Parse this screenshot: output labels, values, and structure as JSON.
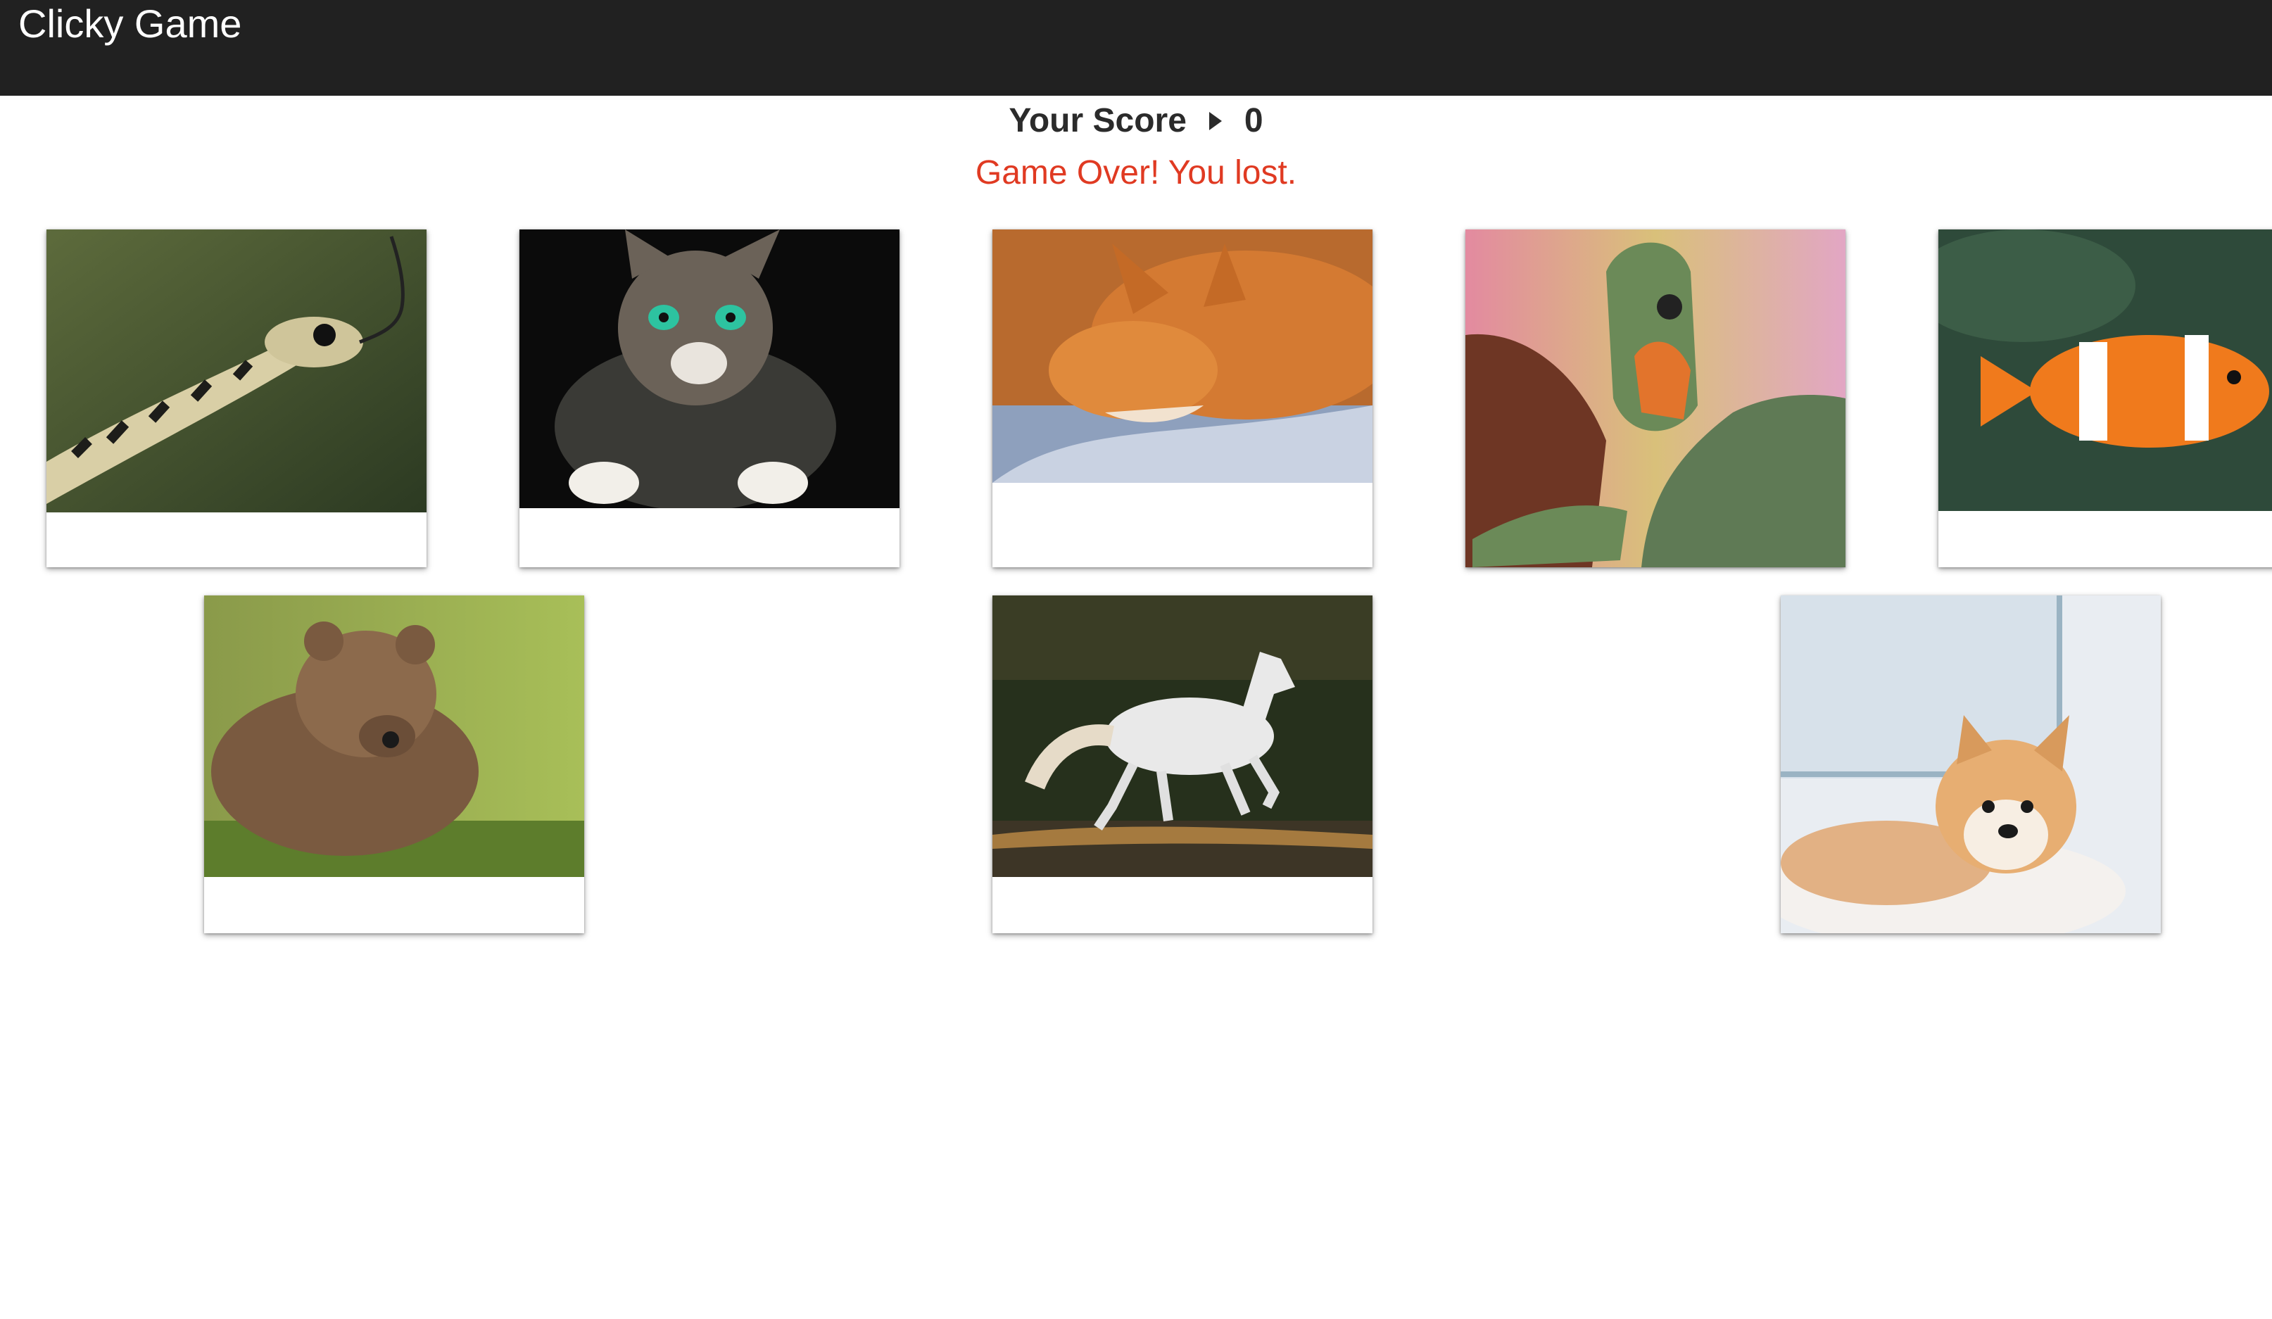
{
  "navbar": {
    "brand": "Clicky Game"
  },
  "score": {
    "label": "Your Score",
    "value": "0",
    "separator_icon": "caret-right-icon"
  },
  "status": {
    "message": "Game Over! You lost.",
    "color": "#e03a22"
  },
  "cards": [
    {
      "name": "snake"
    },
    {
      "name": "cat"
    },
    {
      "name": "fox"
    },
    {
      "name": "turtle"
    },
    {
      "name": "clownfish"
    },
    {
      "name": "bear"
    },
    {
      "name": "horse"
    },
    {
      "name": "shiba-dog"
    }
  ]
}
